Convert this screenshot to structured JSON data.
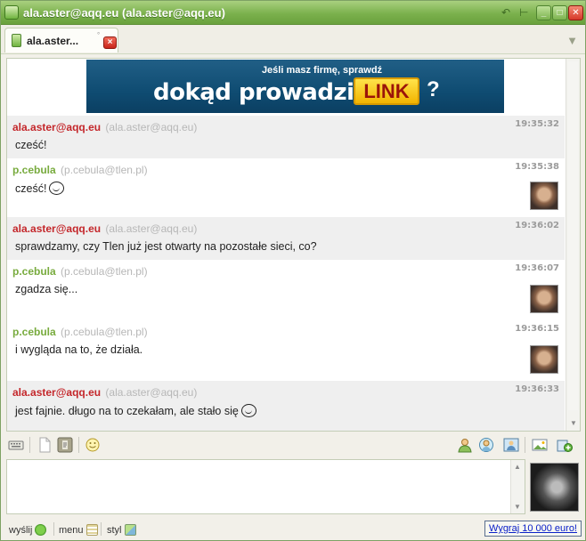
{
  "window": {
    "title": "ala.aster@aqq.eu (ala.aster@aqq.eu)"
  },
  "tab": {
    "label": "ala.aster...",
    "pin_glyph": "°",
    "close_glyph": "×"
  },
  "banner": {
    "line1": "Jeśli masz firmę, sprawdź",
    "line2": "dokąd prowadzi ten",
    "link": "LINK",
    "q": "?"
  },
  "messages": [
    {
      "sender": "ala.aster@aqq.eu",
      "jid": "(ala.aster@aqq.eu)",
      "time": "19:35:32",
      "text": "cześć!",
      "direction": "out",
      "smiley": false,
      "avatar": false
    },
    {
      "sender": "p.cebula",
      "jid": "(p.cebula@tlen.pl)",
      "time": "19:35:38",
      "text": "cześć!",
      "direction": "in",
      "smiley": true,
      "avatar": true
    },
    {
      "sender": "ala.aster@aqq.eu",
      "jid": "(ala.aster@aqq.eu)",
      "time": "19:36:02",
      "text": "sprawdzamy, czy Tlen już jest otwarty na pozostałe sieci, co?",
      "direction": "out",
      "smiley": false,
      "avatar": false
    },
    {
      "sender": "p.cebula",
      "jid": "(p.cebula@tlen.pl)",
      "time": "19:36:07",
      "text": "zgadza się...",
      "direction": "in",
      "smiley": false,
      "avatar": true
    },
    {
      "sender": "p.cebula",
      "jid": "(p.cebula@tlen.pl)",
      "time": "19:36:15",
      "text": "i wygląda na to, że działa.",
      "direction": "in",
      "smiley": false,
      "avatar": true
    },
    {
      "sender": "ala.aster@aqq.eu",
      "jid": "(ala.aster@aqq.eu)",
      "time": "19:36:33",
      "text": "jest fajnie. długo na to czekałam, ale stało się",
      "direction": "out",
      "smiley": true,
      "avatar": false
    }
  ],
  "statusbar": {
    "send_label": "wyślij",
    "menu_label": "menu",
    "style_label": "styl",
    "promo_link": "Wygraj 10 000 euro!"
  },
  "icons": {
    "title_buttons": [
      "back-icon",
      "pin-icon",
      "minimize-icon",
      "maximize-icon",
      "close-icon"
    ],
    "toolbar_left": [
      "keyboard-icon",
      "document-icon",
      "paste-icon",
      "emoticon-icon"
    ],
    "toolbar_right": [
      "contact-icon",
      "contact-info-icon",
      "picture-icon",
      "image-icon",
      "send-file-icon"
    ]
  },
  "colors": {
    "outgoing_sender": "#c4272b",
    "incoming_sender": "#78ab3e",
    "promo_link": "#0b20c8"
  }
}
